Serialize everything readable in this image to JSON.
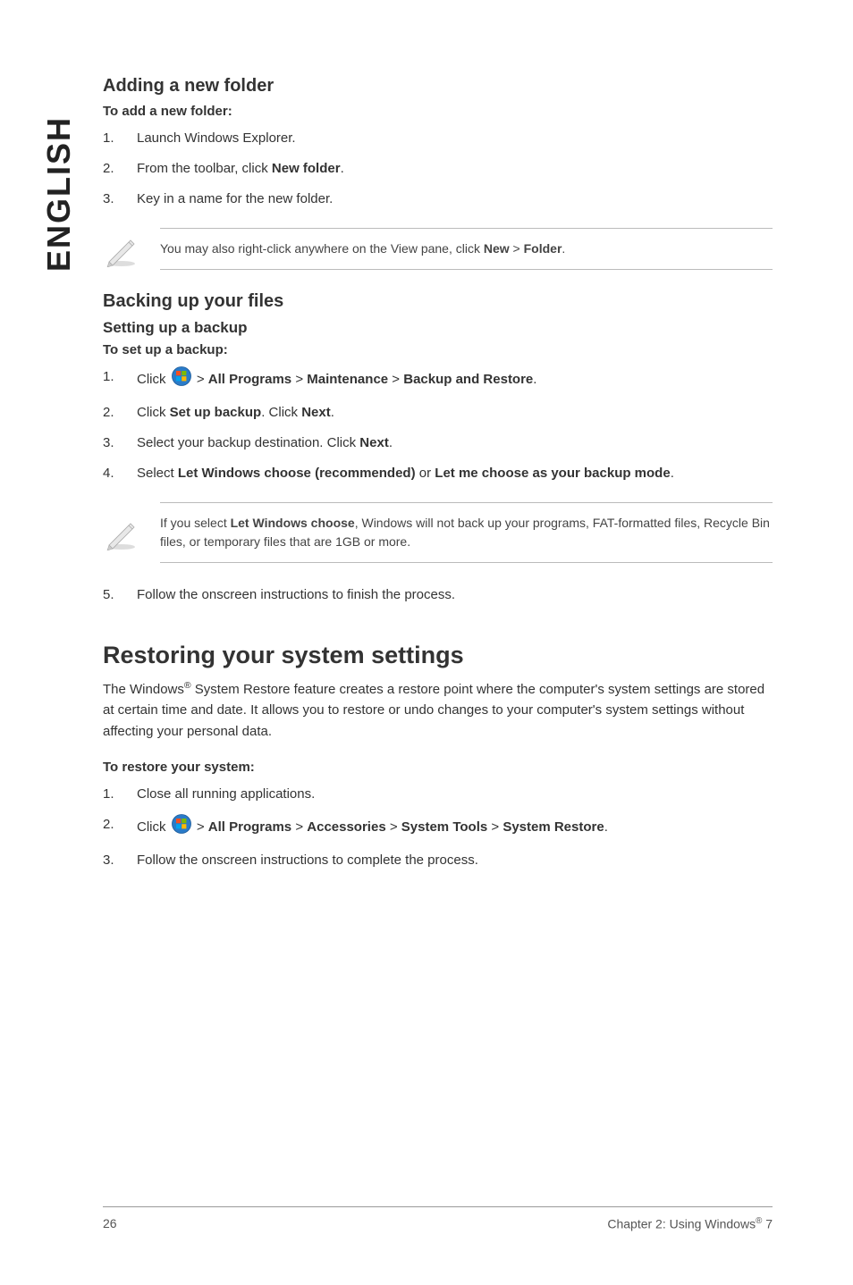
{
  "sidebar": "ENGLISH",
  "section_addfolder": {
    "title": "Adding a new folder",
    "subtitle": "To add a new folder:",
    "steps": {
      "s1_num": "1.",
      "s1": "Launch Windows Explorer.",
      "s2_num": "2.",
      "s2_a": "From the toolbar, click ",
      "s2_b": "New folder",
      "s2_c": ".",
      "s3_num": "3.",
      "s3": "Key in a name for the new folder."
    },
    "note_a": "You may also right-click anywhere on the View pane, click ",
    "note_b": "New",
    "note_c": " > ",
    "note_d": "Folder",
    "note_e": "."
  },
  "section_backup": {
    "title": "Backing up your files",
    "subtitle": "Setting up a backup",
    "subsub": "To set up a backup:",
    "steps": {
      "s1_num": "1.",
      "s1_a": "Click ",
      "s1_b": " > ",
      "s1_c": "All Programs",
      "s1_d": " > ",
      "s1_e": "Maintenance",
      "s1_f": " > ",
      "s1_g": "Backup and Restore",
      "s1_h": ".",
      "s2_num": "2.",
      "s2_a": "Click ",
      "s2_b": "Set up backup",
      "s2_c": ". Click ",
      "s2_d": "Next",
      "s2_e": ".",
      "s3_num": "3.",
      "s3_a": "Select your backup destination. Click ",
      "s3_b": "Next",
      "s3_c": ".",
      "s4_num": "4.",
      "s4_a": "Select ",
      "s4_b": "Let Windows choose (recommended)",
      "s4_c": " or ",
      "s4_d": "Let me choose as your backup mode",
      "s4_e": "."
    },
    "note_a": "If you select ",
    "note_b": "Let Windows choose",
    "note_c": ", Windows will not back up your programs, FAT-formatted files, Recycle Bin files, or temporary files that are 1GB or more.",
    "step5_num": "5.",
    "step5": "Follow the onscreen instructions to finish the process."
  },
  "section_restore": {
    "title": "Restoring your system settings",
    "intro_a": "The Windows",
    "intro_sup": "®",
    "intro_b": " System Restore feature creates a restore point where the computer's system settings are stored at certain time and date. It allows you to restore or undo changes to your computer's system settings without affecting your personal data.",
    "subtitle": "To restore your system:",
    "steps": {
      "s1_num": "1.",
      "s1": "Close all running applications.",
      "s2_num": "2.",
      "s2_a": "Click ",
      "s2_b": " > ",
      "s2_c": "All Programs",
      "s2_d": " > ",
      "s2_e": "Accessories",
      "s2_f": " > ",
      "s2_g": "System Tools",
      "s2_h": " > ",
      "s2_i": "System Restore",
      "s2_j": ".",
      "s3_num": "3.",
      "s3": "Follow the onscreen instructions to complete the process."
    }
  },
  "footer": {
    "page": "26",
    "right_a": "Chapter 2: Using Windows",
    "right_sup": "®",
    "right_b": " 7"
  }
}
